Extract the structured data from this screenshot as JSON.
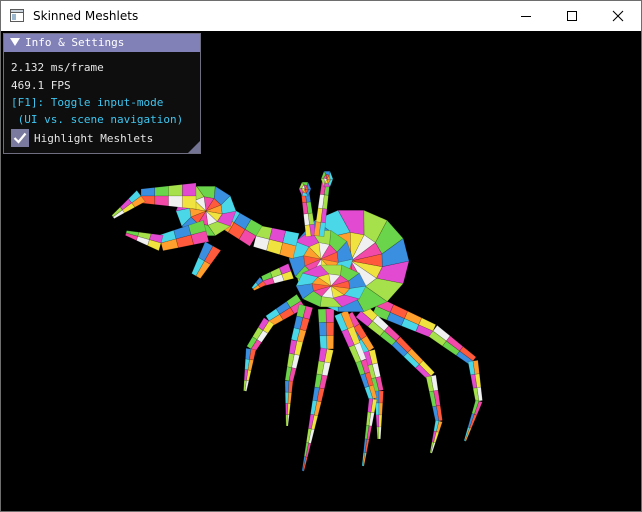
{
  "window": {
    "title": "Skinned Meshlets"
  },
  "controls": {
    "minimize": "minimize-icon",
    "maximize": "maximize-icon",
    "close": "close-icon"
  },
  "panel": {
    "title": "Info & Settings",
    "frame_time": "2.132 ms/frame",
    "fps": "469.1 FPS",
    "hint_line1": "[F1]: Toggle input-mode",
    "hint_line2": " (UI vs. scene navigation)",
    "checkbox_label": "Highlight Meshlets",
    "checkbox_checked": true
  },
  "colors": {
    "panel_header": "#8181b8",
    "hint_text": "#3ec6f0",
    "meshlet_palette": [
      "#f24aa9",
      "#4ad8e8",
      "#f0e340",
      "#6ad44a",
      "#ff5a3c",
      "#e24ad1",
      "#f0f0f0",
      "#3a8fe0",
      "#ff9f2e",
      "#a6e04a"
    ]
  }
}
